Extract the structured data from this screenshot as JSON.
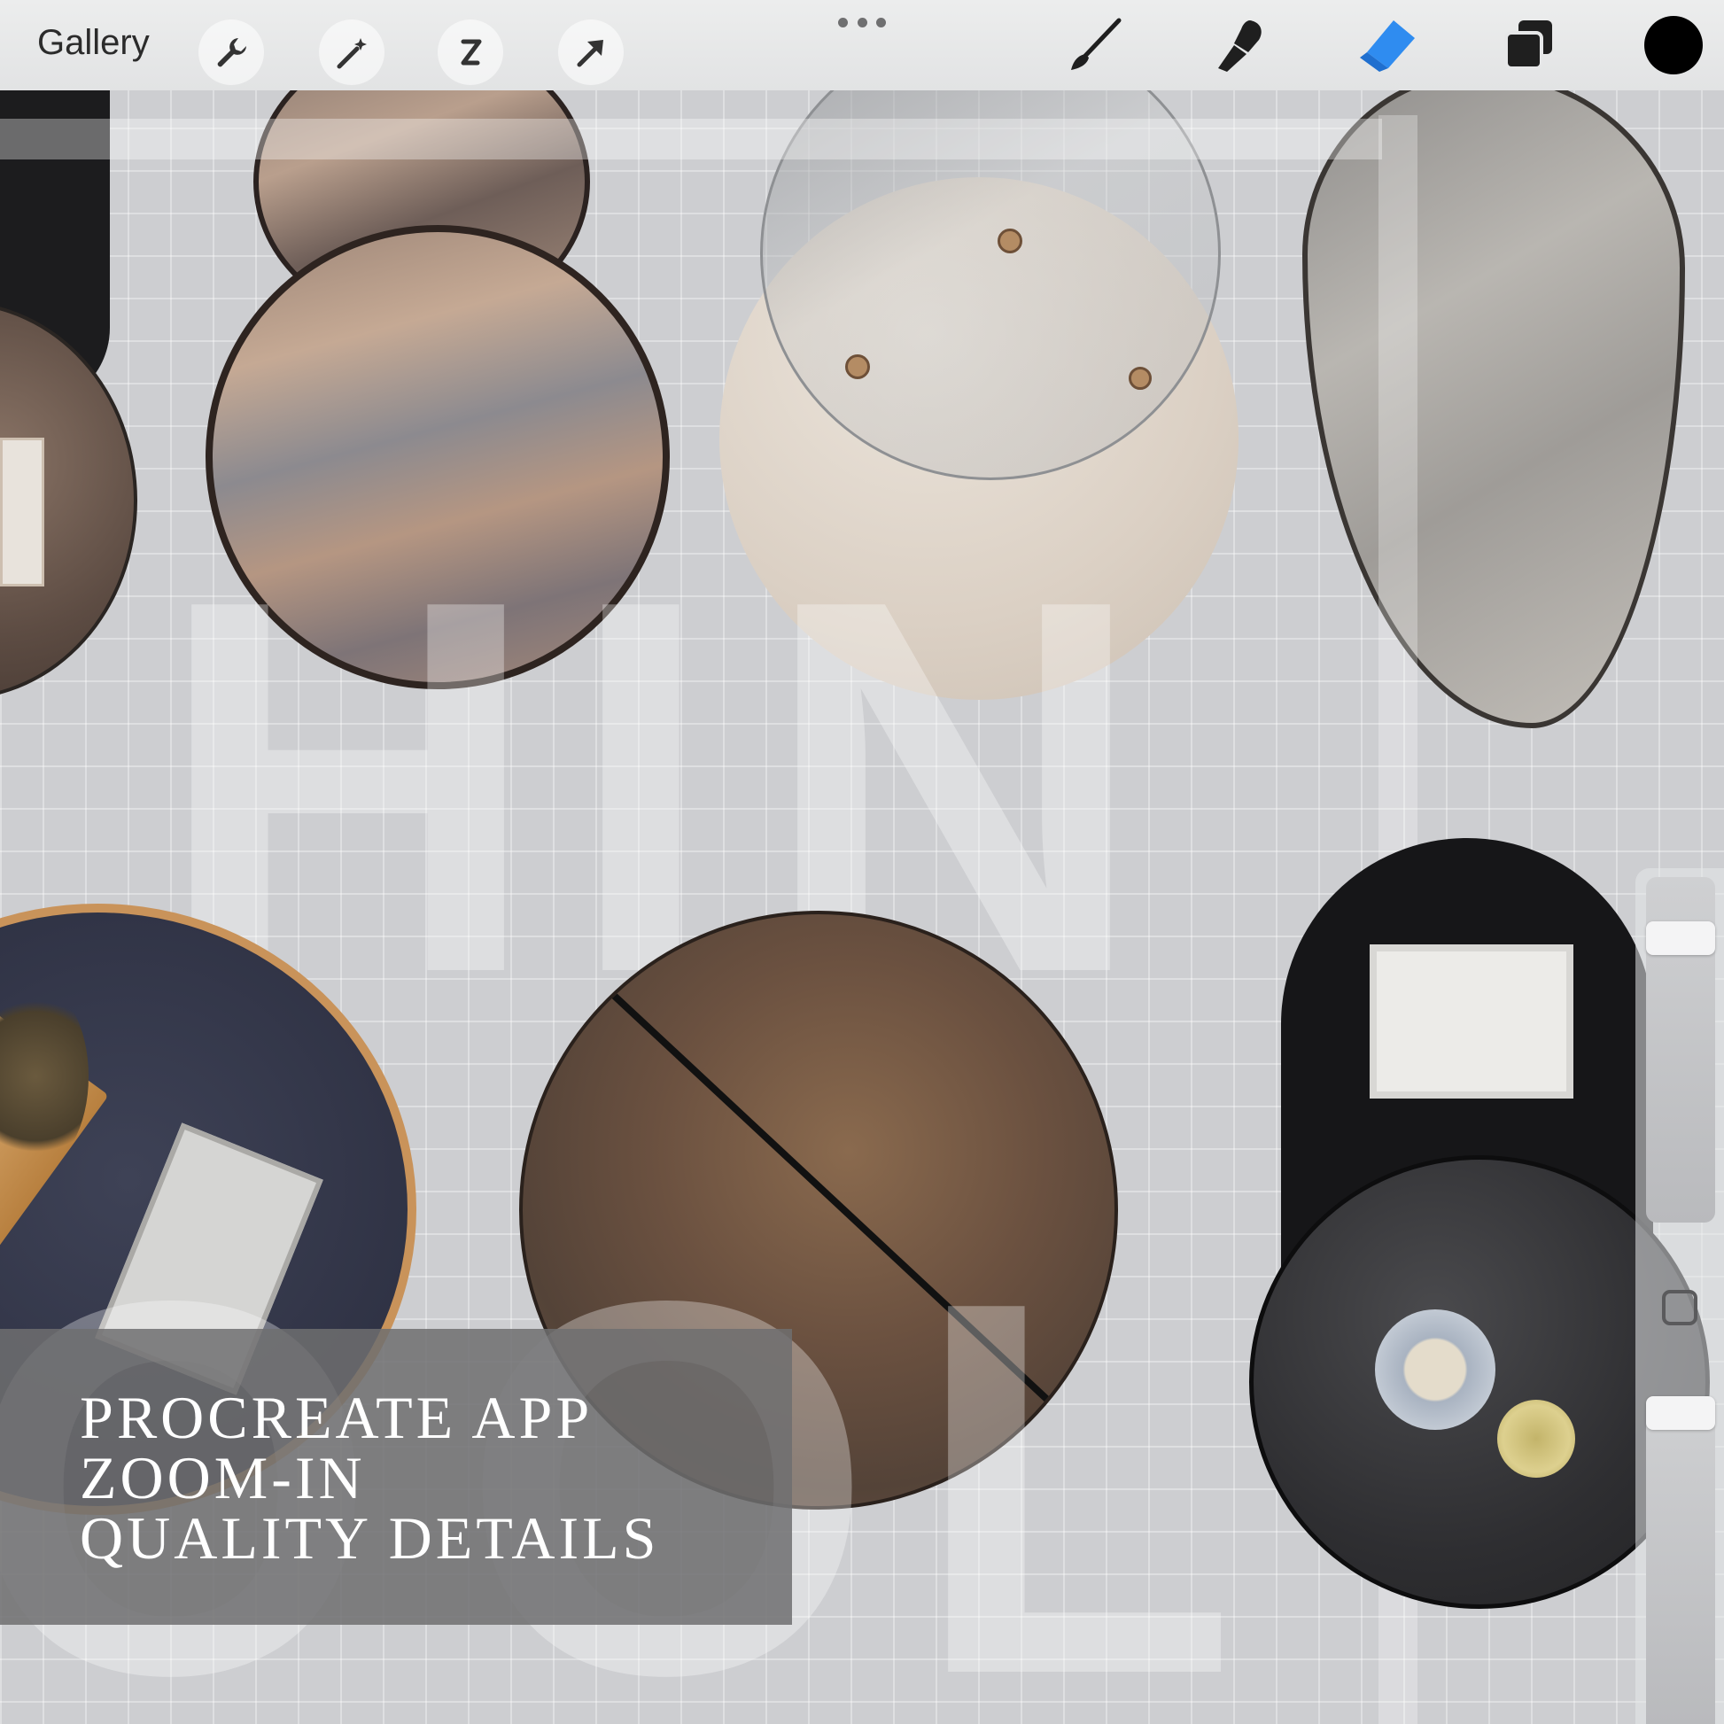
{
  "toolbar": {
    "gallery_label": "Gallery",
    "left_tools": [
      "wrench-icon",
      "magic-wand-icon",
      "selection-icon",
      "transform-arrow-icon"
    ],
    "right_tools": [
      "brush-icon",
      "smudge-icon",
      "eraser-icon",
      "layers-icon"
    ],
    "active_tool": "eraser-icon",
    "active_color": "#000000",
    "accent_color": "#2f8cf0"
  },
  "canvas": {
    "watermark_letters": [
      "H",
      "I",
      "N",
      "O",
      "O",
      "L"
    ]
  },
  "sidebar": {
    "brush_size_slider": "brush-size",
    "opacity_slider": "opacity",
    "modify_button": "modify-square-icon"
  },
  "caption": {
    "line1": "PROCREATE APP",
    "line2": "ZOOM-IN",
    "line3": "QUALITY DETAILS"
  }
}
